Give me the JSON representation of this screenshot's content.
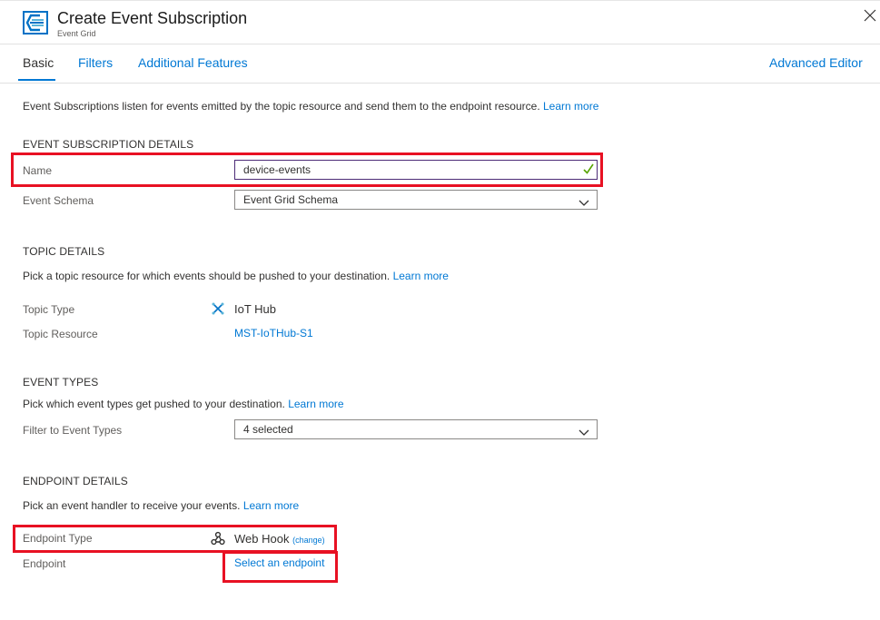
{
  "header": {
    "title": "Create Event Subscription",
    "subtitle": "Event Grid",
    "icon": "event-grid-icon",
    "close_icon": "close-icon"
  },
  "tabs": [
    {
      "label": "Basic",
      "active": true
    },
    {
      "label": "Filters",
      "active": false
    },
    {
      "label": "Additional Features",
      "active": false
    }
  ],
  "advanced_editor": "Advanced Editor",
  "intro": {
    "text": "Event Subscriptions listen for events emitted by the topic resource and send them to the endpoint resource.",
    "link": "Learn more"
  },
  "subscription_details": {
    "heading": "EVENT SUBSCRIPTION DETAILS",
    "name_label": "Name",
    "name_value": "device-events",
    "schema_label": "Event Schema",
    "schema_value": "Event Grid Schema"
  },
  "topic_details": {
    "heading": "TOPIC DETAILS",
    "desc": "Pick a topic resource for which events should be pushed to your destination.",
    "link": "Learn more",
    "type_label": "Topic Type",
    "type_value": "IoT Hub",
    "type_icon": "iot-hub-icon",
    "resource_label": "Topic Resource",
    "resource_value": "MST-IoTHub-S1"
  },
  "event_types": {
    "heading": "EVENT TYPES",
    "desc": "Pick which event types get pushed to your destination.",
    "link": "Learn more",
    "filter_label": "Filter to Event Types",
    "filter_value": "4 selected"
  },
  "endpoint_details": {
    "heading": "ENDPOINT DETAILS",
    "desc": "Pick an event handler to receive your events.",
    "link": "Learn more",
    "type_label": "Endpoint Type",
    "type_value": "Web Hook",
    "type_icon": "webhook-icon",
    "change_link": "(change)",
    "endpoint_label": "Endpoint",
    "endpoint_link": "Select an endpoint"
  },
  "colors": {
    "accent": "#0078d4",
    "highlight": "#e81123",
    "valid": "#57a300"
  }
}
